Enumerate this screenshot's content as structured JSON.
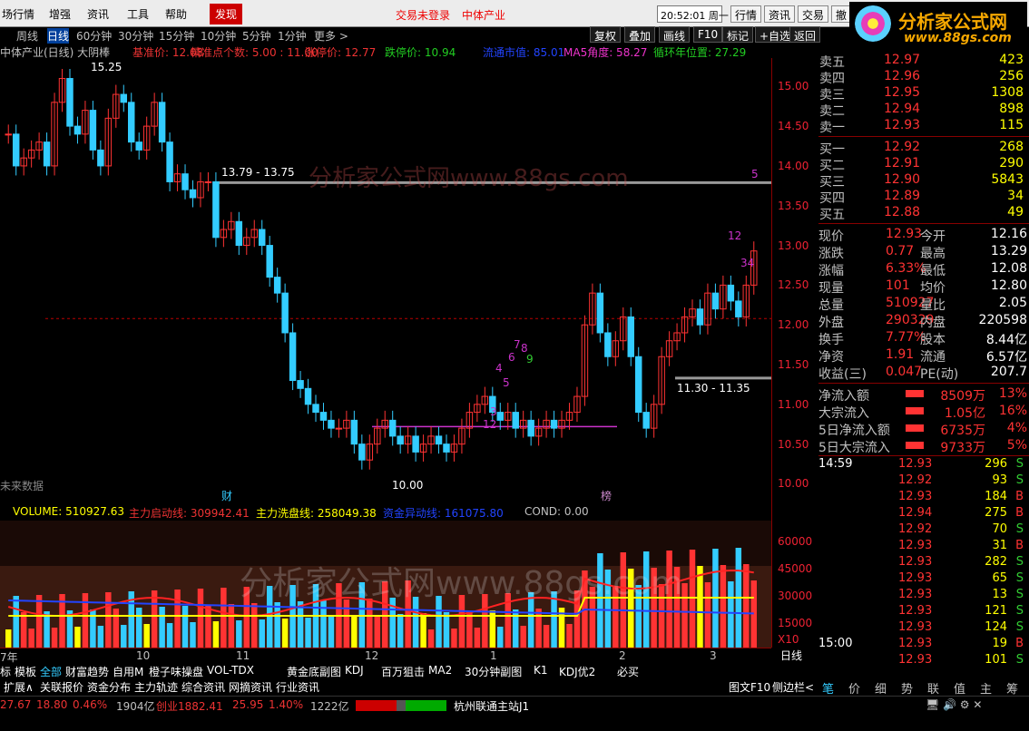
{
  "menu": {
    "items": [
      "场行情",
      "增强",
      "资讯",
      "工具",
      "帮助"
    ],
    "active": "发现",
    "login": "交易未登录",
    "stock_name": "中体产业",
    "clock": "20:52:01 周一",
    "buttons": [
      "行情",
      "资讯",
      "交易",
      "撤"
    ]
  },
  "logo": {
    "title": "分析家公式网",
    "url": "www.88gs.com"
  },
  "periods": {
    "items": [
      "周线",
      "日线",
      "60分钟",
      "30分钟",
      "15分钟",
      "10分钟",
      "5分钟",
      "1分钟",
      "更多 >"
    ],
    "selected": "日线"
  },
  "toolbar": [
    "复权",
    "叠加",
    "画线",
    "F10",
    "标记",
    "+自选",
    "返回"
  ],
  "title_line": {
    "name": "中体产业(日线) 大阴棒",
    "base": "基准价: 12.08",
    "accuracy": "精准点个数: 5.00 : 11.00",
    "limit_up": "涨停价: 12.77",
    "limit_down": "跌停价: 10.94",
    "mktcap": "流通市值: 85.01",
    "ma5": "MA5角度: 58.27",
    "cycle": "循环年位置: 27.29"
  },
  "chart_data": {
    "type": "candlestick",
    "ylim": [
      9.8,
      15.3
    ],
    "yticks": [
      "15.00",
      "14.50",
      "14.00",
      "13.50",
      "13.00",
      "12.50",
      "12.00",
      "11.50",
      "11.00",
      "10.50",
      "10.00"
    ],
    "annotations": [
      "15.25",
      "13.79 - 13.75",
      "10.00",
      "11.30 - 11.35",
      "财",
      "榜",
      "5",
      "12",
      "34",
      "12",
      "6",
      "7",
      "8",
      "9",
      "5",
      "4",
      "3"
    ],
    "no_future": "未来数据",
    "volume": {
      "labels": [
        "VOLUME: 510927.63",
        "主力启动线: 309942.41",
        "主力洗盘线: 258049.38",
        "资金异动线: 161075.80",
        "COND: 0.00"
      ],
      "yticks": [
        "60000",
        "45000",
        "30000",
        "15000"
      ],
      "unit": "X10"
    },
    "dates": [
      "7年",
      "10",
      "11",
      "12",
      "1",
      "2",
      "3"
    ],
    "closes": [
      14.4,
      14.0,
      14.1,
      14.2,
      14.3,
      14.0,
      14.8,
      15.1,
      14.5,
      14.4,
      14.7,
      14.2,
      14.0,
      14.6,
      14.9,
      14.8,
      14.3,
      14.2,
      14.5,
      14.8,
      14.3,
      13.8,
      13.9,
      13.7,
      13.6,
      13.8,
      13.8,
      13.1,
      13.2,
      13.3,
      13.0,
      13.1,
      13.2,
      13.0,
      12.6,
      12.4,
      11.9,
      11.3,
      11.2,
      11.0,
      10.9,
      10.8,
      10.7,
      10.7,
      10.8,
      10.5,
      10.3,
      10.5,
      10.7,
      10.8,
      10.6,
      10.5,
      10.6,
      10.4,
      10.5,
      10.6,
      10.5,
      10.4,
      10.5,
      10.7,
      10.9,
      11.0,
      11.1,
      10.9,
      10.8,
      10.9,
      10.7,
      10.8,
      10.6,
      10.7,
      10.8,
      10.7,
      10.8,
      10.9,
      11.1,
      12.0,
      12.4,
      11.9,
      11.6,
      11.8,
      12.1,
      11.6,
      10.9,
      10.7,
      11.0,
      11.6,
      11.8,
      11.9,
      12.1,
      12.2,
      12.0,
      12.4,
      12.2,
      12.5,
      12.3,
      12.1,
      12.5,
      12.93
    ]
  },
  "axis_day": "日线",
  "tabs1": [
    "标",
    "模板",
    "全部",
    "财富趋势",
    "自用M",
    "橙子味操盘",
    "VOL-TDX",
    "黄金底副图",
    "KDJ",
    "百万狙击",
    "MA2",
    "30分钟副图",
    "K1",
    "KDJ优2",
    "必买"
  ],
  "tabs2": [
    "扩展∧",
    "关联报价",
    "资金分布",
    "主力轨迹",
    "综合资讯",
    "网摘资讯",
    "行业资讯"
  ],
  "right_tabs2": [
    "图文F10",
    "侧边栏<"
  ],
  "status": {
    "idx1": "27.67",
    "idx2": "18.80",
    "idx3": "0.46%",
    "idx4": "1904亿",
    "cy": "创业1882.41",
    "cy2": "25.95",
    "cy3": "1.40%",
    "cy4": "1222亿",
    "site": "杭州联通主站J1"
  },
  "quote": {
    "asks": [
      [
        "卖五",
        "12.97",
        "423"
      ],
      [
        "卖四",
        "12.96",
        "256"
      ],
      [
        "卖三",
        "12.95",
        "1308"
      ],
      [
        "卖二",
        "12.94",
        "898"
      ],
      [
        "卖一",
        "12.93",
        "115"
      ]
    ],
    "bids": [
      [
        "买一",
        "12.92",
        "268"
      ],
      [
        "买二",
        "12.91",
        "290"
      ],
      [
        "买三",
        "12.90",
        "5843"
      ],
      [
        "买四",
        "12.89",
        "34"
      ],
      [
        "买五",
        "12.88",
        "49"
      ]
    ]
  },
  "info": [
    [
      "现价",
      "12.93",
      "今开",
      "12.16"
    ],
    [
      "涨跌",
      "0.77",
      "最高",
      "13.29"
    ],
    [
      "涨幅",
      "6.33%",
      "最低",
      "12.08"
    ],
    [
      "现量",
      "101",
      "均价",
      "12.80"
    ],
    [
      "总量",
      "510927",
      "量比",
      "2.05"
    ],
    [
      "外盘",
      "290329",
      "内盘",
      "220598"
    ],
    [
      "换手",
      "7.77%",
      "股本",
      "8.44亿"
    ],
    [
      "净资",
      "1.91",
      "流通",
      "6.57亿"
    ],
    [
      "收益(三)",
      "0.047",
      "PE(动)",
      "207.7"
    ]
  ],
  "flows": [
    [
      "净流入额",
      "8509万",
      "13%"
    ],
    [
      "大宗流入",
      "1.05亿",
      "16%"
    ],
    [
      "5日净流入额",
      "6735万",
      "4%"
    ],
    [
      "5日大宗流入",
      "9733万",
      "5%"
    ]
  ],
  "ticks": [
    [
      "14:59",
      "12.93",
      "296",
      "S"
    ],
    [
      "",
      "12.92",
      "93",
      "S"
    ],
    [
      "",
      "12.93",
      "184",
      "B"
    ],
    [
      "",
      "12.94",
      "275",
      "B"
    ],
    [
      "",
      "12.92",
      "70",
      "S"
    ],
    [
      "",
      "12.93",
      "31",
      "B"
    ],
    [
      "",
      "12.93",
      "282",
      "S"
    ],
    [
      "",
      "12.93",
      "65",
      "S"
    ],
    [
      "",
      "12.93",
      "13",
      "S"
    ],
    [
      "",
      "12.93",
      "121",
      "S"
    ],
    [
      "",
      "12.93",
      "124",
      "S"
    ],
    [
      "15:00",
      "12.93",
      "19",
      "B"
    ],
    [
      "",
      "12.93",
      "101",
      "S"
    ]
  ],
  "bottom_tabs": [
    "笔",
    "价",
    "细",
    "势",
    "联",
    "值",
    "主",
    "筹"
  ],
  "watermark": "分析家公式网www.88gs.com"
}
